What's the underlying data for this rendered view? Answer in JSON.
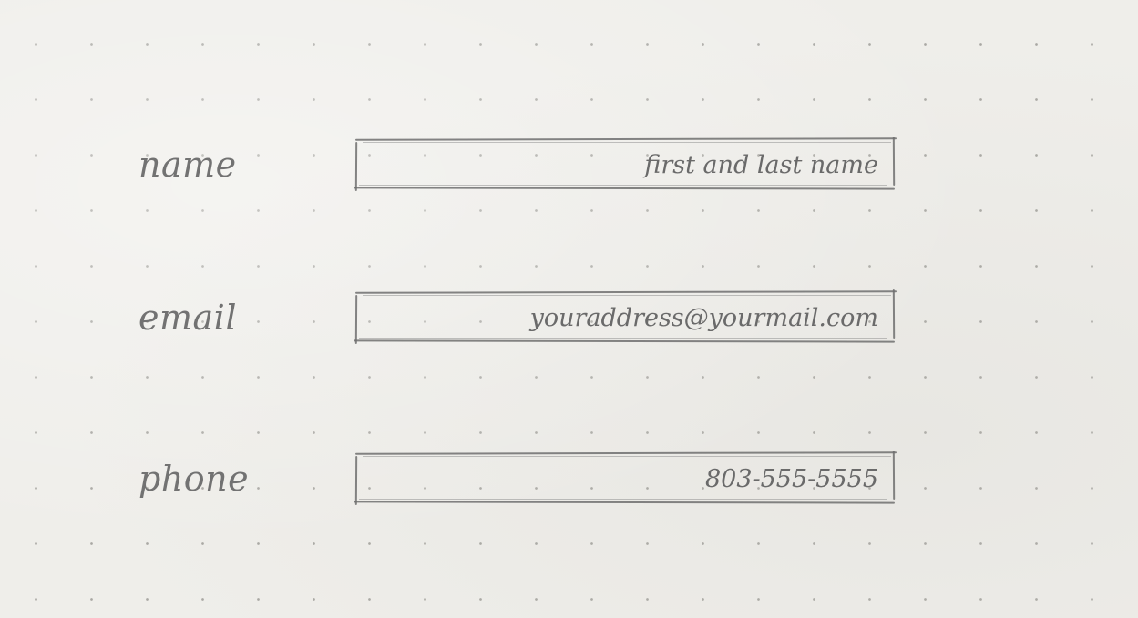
{
  "form": {
    "fields": [
      {
        "id": "name",
        "label": "name",
        "placeholder": "first and last name",
        "value": ""
      },
      {
        "id": "email",
        "label": "email",
        "placeholder": "youraddress@yourmail.com",
        "value": ""
      },
      {
        "id": "phone",
        "label": "phone",
        "placeholder": "803-555-5555",
        "value": ""
      }
    ]
  },
  "colors": {
    "paper": "#efeeea",
    "dot": "#a9a8a3",
    "ink": "#6c6c6c"
  }
}
